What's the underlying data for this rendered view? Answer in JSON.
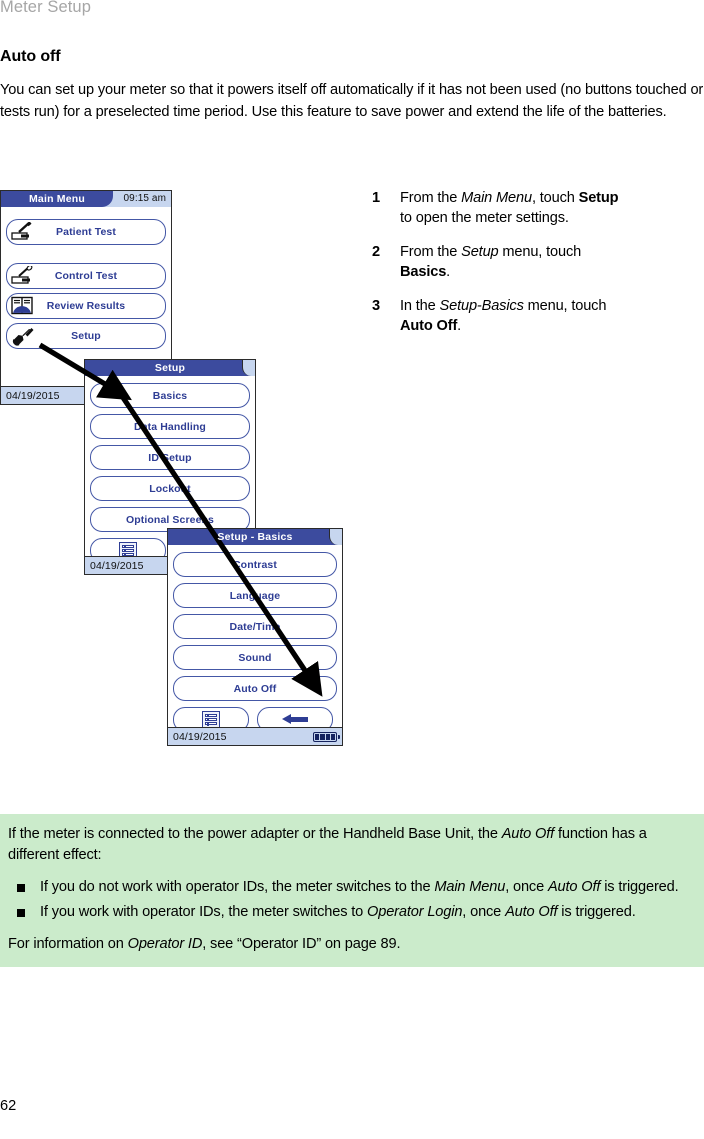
{
  "running_head": "Meter Setup",
  "section": {
    "title": "Auto off",
    "intro": "You can set up your meter so that it powers itself off automatically if it has not been used (no buttons touched or tests run) for a preselected time period. Use this feature to save power and extend the life of the batteries."
  },
  "steps": [
    {
      "num": "1",
      "parts": [
        {
          "t": "From the ",
          "s": "plain"
        },
        {
          "t": "Main Menu",
          "s": "italic"
        },
        {
          "t": ", touch ",
          "s": "plain"
        },
        {
          "t": "Setup",
          "s": "bold"
        },
        {
          "t": " to open the meter settings.",
          "s": "plain"
        }
      ]
    },
    {
      "num": "2",
      "parts": [
        {
          "t": "From the ",
          "s": "plain"
        },
        {
          "t": "Setup",
          "s": "italic"
        },
        {
          "t": " menu, touch ",
          "s": "plain"
        },
        {
          "t": "Basics",
          "s": "bold"
        },
        {
          "t": ".",
          "s": "plain"
        }
      ]
    },
    {
      "num": "3",
      "parts": [
        {
          "t": "In the ",
          "s": "plain"
        },
        {
          "t": "Setup-Basics",
          "s": "italic"
        },
        {
          "t": " menu, touch ",
          "s": "plain"
        },
        {
          "t": "Auto Off",
          "s": "bold"
        },
        {
          "t": ".",
          "s": "plain"
        }
      ]
    }
  ],
  "screens": {
    "main_menu": {
      "title": "Main Menu",
      "clock": "09:15 am",
      "date": "04/19/2015",
      "items": [
        {
          "label": "Patient Test",
          "icon": "lancet-strip-icon"
        },
        {
          "label": "Control Test",
          "icon": "control-vial-strip-icon"
        },
        {
          "label": "Review Results",
          "icon": "open-book-icon"
        },
        {
          "label": "Setup",
          "icon": "wrench-icon"
        }
      ]
    },
    "setup": {
      "title": "Setup",
      "date": "04/19/2015",
      "items": [
        {
          "label": "Basics"
        },
        {
          "label": "Data Handling"
        },
        {
          "label": "ID Setup"
        },
        {
          "label": "Lockout"
        },
        {
          "label": "Optional Screens"
        }
      ],
      "footer_buttons": [
        {
          "icon": "list-menu-icon"
        }
      ]
    },
    "setup_basics": {
      "title": "Setup - Basics",
      "date": "04/19/2015",
      "items": [
        {
          "label": "Contrast"
        },
        {
          "label": "Language"
        },
        {
          "label": "Date/Time"
        },
        {
          "label": "Sound"
        },
        {
          "label": "Auto Off"
        }
      ],
      "footer_buttons": [
        {
          "icon": "list-menu-icon"
        },
        {
          "icon": "back-arrow-icon"
        }
      ],
      "battery": "battery-full-icon"
    }
  },
  "note": {
    "lead_parts": [
      {
        "t": "If the meter is connected to the power adapter or the Handheld Base Unit, the ",
        "s": "plain"
      },
      {
        "t": "Auto Off",
        "s": "italic"
      },
      {
        "t": " function has a different effect:",
        "s": "plain"
      }
    ],
    "bullets": [
      [
        {
          "t": "If you do not work with operator IDs, the meter switches to the ",
          "s": "plain"
        },
        {
          "t": "Main Menu",
          "s": "italic"
        },
        {
          "t": ", once ",
          "s": "plain"
        },
        {
          "t": "Auto Off",
          "s": "italic"
        },
        {
          "t": " is triggered.",
          "s": "plain"
        }
      ],
      [
        {
          "t": "If you work with operator IDs, the meter switches to ",
          "s": "plain"
        },
        {
          "t": "Operator Login",
          "s": "italic"
        },
        {
          "t": ", once ",
          "s": "plain"
        },
        {
          "t": "Auto Off",
          "s": "italic"
        },
        {
          "t": " is triggered.",
          "s": "plain"
        }
      ]
    ],
    "tail_parts": [
      {
        "t": "For information on ",
        "s": "plain"
      },
      {
        "t": "Operator ID",
        "s": "italic"
      },
      {
        "t": ", see “Operator ID” on page 89.",
        "s": "plain"
      }
    ]
  },
  "folio": "62",
  "colors": {
    "titlebar_blue": "#3c4b9e",
    "label_blue": "#2e3d94",
    "panel_light_blue": "#c7d6ef",
    "note_green": "#cbebcb",
    "running_head_gray": "#a6a6a6"
  }
}
